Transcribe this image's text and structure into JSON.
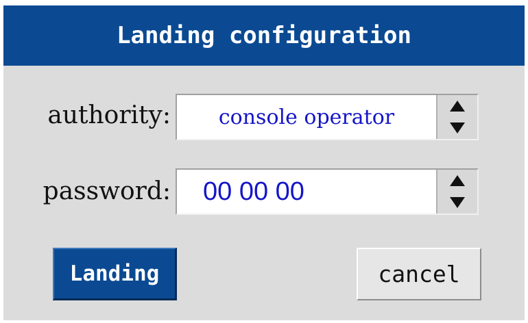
{
  "dialog": {
    "title": "Landing configuration"
  },
  "authority": {
    "label": "authority:",
    "value": "console operator"
  },
  "password": {
    "label": "password:",
    "value": "00 00 00"
  },
  "buttons": {
    "landing_label": "Landing",
    "cancel_label": "cancel"
  },
  "icons": {
    "spinner_up": "triangle-up-icon",
    "spinner_down": "triangle-down-icon"
  },
  "colors": {
    "title_bar": "#0b4a92",
    "dialog_background": "#dcdcdc",
    "value_text": "#1515c8",
    "primary_button": "#0b4a92"
  }
}
